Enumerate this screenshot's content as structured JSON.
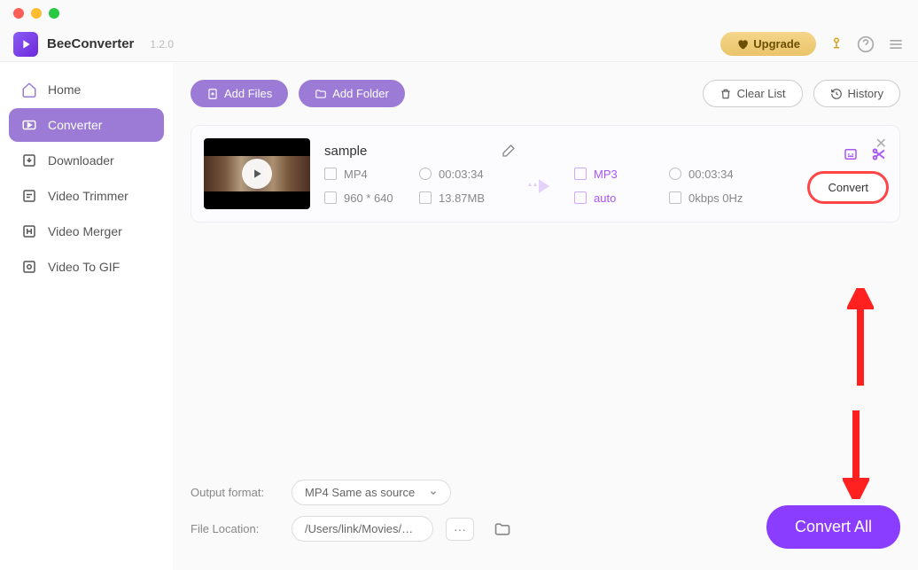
{
  "app": {
    "name": "BeeConverter",
    "version": "1.2.0"
  },
  "header": {
    "upgrade_label": "Upgrade"
  },
  "sidebar": {
    "items": [
      {
        "label": "Home",
        "id": "home"
      },
      {
        "label": "Converter",
        "id": "converter"
      },
      {
        "label": "Downloader",
        "id": "downloader"
      },
      {
        "label": "Video Trimmer",
        "id": "trimmer"
      },
      {
        "label": "Video Merger",
        "id": "merger"
      },
      {
        "label": "Video To GIF",
        "id": "gif"
      }
    ]
  },
  "toolbar": {
    "add_files": "Add Files",
    "add_folder": "Add Folder",
    "clear_list": "Clear List",
    "history": "History"
  },
  "file": {
    "name": "sample",
    "source": {
      "format": "MP4",
      "duration": "00:03:34",
      "resolution": "960 * 640",
      "size": "13.87MB"
    },
    "target": {
      "format": "MP3",
      "quality": "auto",
      "duration": "00:03:34",
      "bitrate": "0kbps 0Hz"
    },
    "convert_label": "Convert"
  },
  "bottom": {
    "output_format_label": "Output format:",
    "output_format_value": "MP4 Same as source",
    "file_location_label": "File Location:",
    "file_location_value": "/Users/link/Movies/BeeC"
  },
  "convert_all": "Convert All"
}
